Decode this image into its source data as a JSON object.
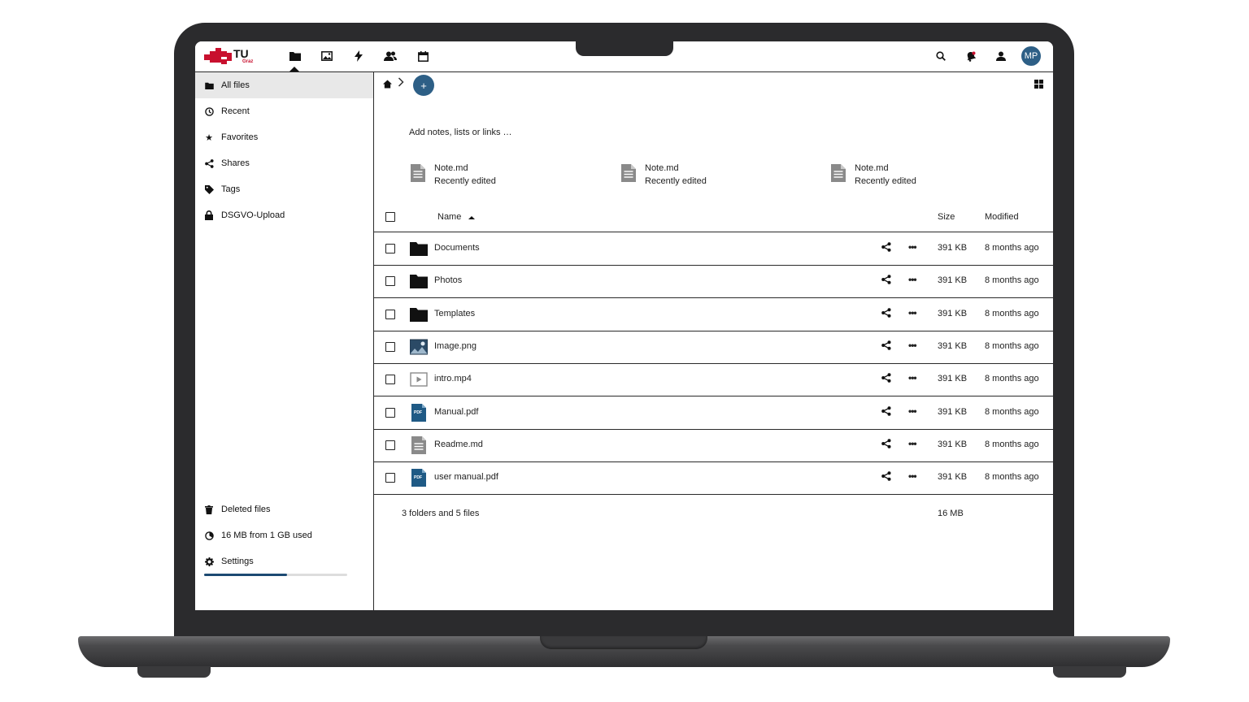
{
  "topbar": {
    "logo_text": "TU",
    "logo_sub": "Graz",
    "apps": [
      {
        "icon": "folder-icon",
        "name": "Files"
      },
      {
        "icon": "photos-icon",
        "name": "Photos"
      },
      {
        "icon": "activity-icon",
        "name": "Activity"
      },
      {
        "icon": "contacts-icon",
        "name": "Contacts"
      },
      {
        "icon": "calendar-icon",
        "name": "Calendar"
      }
    ],
    "avatar_initials": "MP",
    "accent": "#2d5f86",
    "brand_red": "#c8102e"
  },
  "sidebar": {
    "items": [
      {
        "label": "All files",
        "icon": "folder-icon",
        "active": true
      },
      {
        "label": "Recent",
        "icon": "clock-icon"
      },
      {
        "label": "Favorites",
        "icon": "star-icon"
      },
      {
        "label": "Shares",
        "icon": "share-icon"
      },
      {
        "label": "Tags",
        "icon": "tag-icon"
      },
      {
        "label": "DSGVO-Upload",
        "icon": "lock-icon"
      }
    ],
    "deleted_label": "Deleted files",
    "quota_label": "16 MB from 1 GB used",
    "quota_fraction": 0.58,
    "settings_label": "Settings"
  },
  "main": {
    "new_button": "+",
    "notes_hint": "Add notes, lists or links …",
    "notes": [
      {
        "title": "Note.md",
        "subtitle": "Recently edited"
      },
      {
        "title": "Note.md",
        "subtitle": "Recently edited"
      },
      {
        "title": "Note.md",
        "subtitle": "Recently edited"
      }
    ],
    "columns": {
      "name": "Name",
      "size": "Size",
      "modified": "Modified"
    },
    "files": [
      {
        "name": "Documents",
        "type": "folder",
        "size": "391 KB",
        "modified": "8 months ago"
      },
      {
        "name": "Photos",
        "type": "folder",
        "size": "391 KB",
        "modified": "8 months ago"
      },
      {
        "name": "Templates",
        "type": "folder",
        "size": "391 KB",
        "modified": "8 months ago"
      },
      {
        "name": "Image.png",
        "type": "image",
        "size": "391 KB",
        "modified": "8 months ago"
      },
      {
        "name": "intro.mp4",
        "type": "video",
        "size": "391 KB",
        "modified": "8 months ago"
      },
      {
        "name": "Manual.pdf",
        "type": "pdf",
        "size": "391 KB",
        "modified": "8 months ago"
      },
      {
        "name": "Readme.md",
        "type": "text",
        "size": "391 KB",
        "modified": "8 months ago"
      },
      {
        "name": "user manual.pdf",
        "type": "pdf",
        "size": "391 KB",
        "modified": "8 months ago"
      }
    ],
    "pdf_badge": "PDF",
    "summary": "3 folders and 5 files",
    "summary_size": "16 MB"
  }
}
